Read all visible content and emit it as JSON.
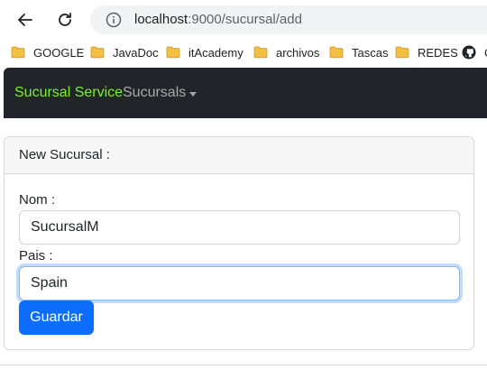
{
  "browser": {
    "url_host": "localhost",
    "url_rest": ":9000/sucursal/add",
    "bookmarks": [
      {
        "label": "GOOGLE",
        "icon": "folder-icon"
      },
      {
        "label": "JavaDoc",
        "icon": "folder-icon"
      },
      {
        "label": "itAcademy",
        "icon": "folder-icon"
      },
      {
        "label": "archivos",
        "icon": "folder-icon"
      },
      {
        "label": "Tascas",
        "icon": "folder-icon"
      },
      {
        "label": "REDES",
        "icon": "folder-icon"
      },
      {
        "label": "C",
        "icon": "github-icon"
      }
    ]
  },
  "navbar": {
    "brand": "Sucursal Service",
    "menu_label": "Sucursals",
    "brand_color": "#7df02e",
    "background": "#212529"
  },
  "card": {
    "header": "New Sucursal :",
    "nom_label": "Nom :",
    "nom_value": "SucursalM",
    "pais_label": "Pais :",
    "pais_value": "Spain",
    "save_label": "Guardar",
    "button_color": "#0d6efd"
  }
}
